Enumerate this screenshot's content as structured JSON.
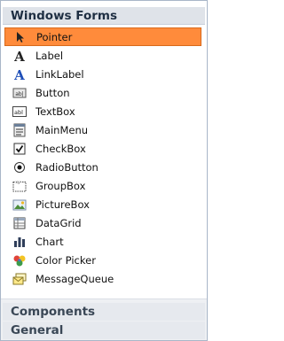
{
  "toolbox": {
    "group_title": "Windows Forms",
    "items": [
      {
        "label": "Pointer",
        "icon": "pointer-icon",
        "selected": true
      },
      {
        "label": "Label",
        "icon": "label-icon"
      },
      {
        "label": "LinkLabel",
        "icon": "linklabel-icon"
      },
      {
        "label": "Button",
        "icon": "button-icon"
      },
      {
        "label": "TextBox",
        "icon": "textbox-icon"
      },
      {
        "label": "MainMenu",
        "icon": "mainmenu-icon"
      },
      {
        "label": "CheckBox",
        "icon": "checkbox-icon"
      },
      {
        "label": "RadioButton",
        "icon": "radiobutton-icon"
      },
      {
        "label": "GroupBox",
        "icon": "groupbox-icon"
      },
      {
        "label": "PictureBox",
        "icon": "picturebox-icon"
      },
      {
        "label": "DataGrid",
        "icon": "datagrid-icon"
      },
      {
        "label": "Chart",
        "icon": "chart-icon"
      },
      {
        "label": "Color Picker",
        "icon": "colorpicker-icon"
      },
      {
        "label": "MessageQueue",
        "icon": "messagequeue-icon"
      }
    ],
    "footer_groups": [
      "Components",
      "General"
    ],
    "colors": {
      "selected": "#ff8b3b",
      "header": "#dfe3e9",
      "border": "#a9b6c8"
    }
  }
}
